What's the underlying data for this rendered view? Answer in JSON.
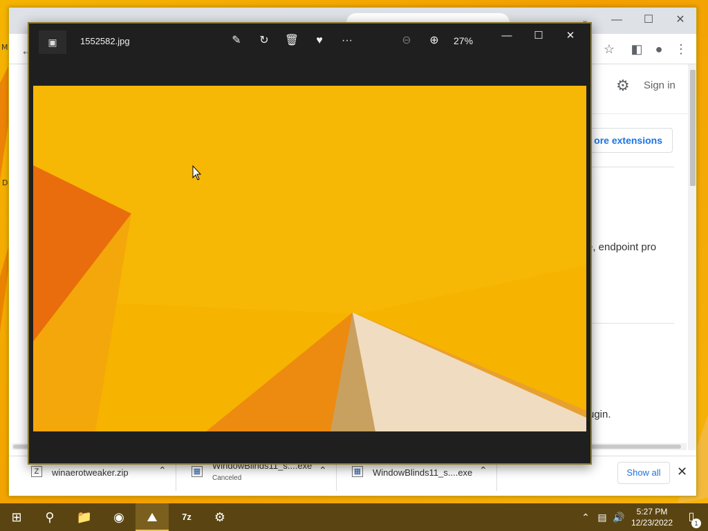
{
  "photos": {
    "filename": "1552582.jpg",
    "zoom": "27%",
    "toolbar": {
      "edit_icon": "edit-image-icon",
      "rotate_icon": "rotate-icon",
      "delete_icon": "trash-icon",
      "favorite_icon": "heart-icon",
      "more_icon": "more-icon",
      "zoom_out_icon": "zoom-out-icon",
      "zoom_in_icon": "zoom-in-icon"
    }
  },
  "browser": {
    "signin_label": "Sign in",
    "more_extensions_label": "ore extensions",
    "text_endpoint": "e, endpoint pro",
    "text_plugin": "ugin."
  },
  "downloads": {
    "items": [
      {
        "name": "winaerotweaker.zip",
        "sub": ""
      },
      {
        "name": "WindowBlinds11_s....exe",
        "sub": "Canceled"
      },
      {
        "name": "WindowBlinds11_s....exe",
        "sub": ""
      }
    ],
    "show_all_label": "Show all"
  },
  "desktop": {
    "label_m": "M",
    "label_d": "D"
  },
  "taskbar": {
    "time": "5:27 PM",
    "date": "12/23/2022",
    "notification_count": "1",
    "apps": [
      "start-icon",
      "search-icon",
      "file-explorer-icon",
      "chrome-icon",
      "photos-icon",
      "7zip-icon",
      "installer-icon"
    ]
  },
  "colors": {
    "wallpaper": "#f5b400",
    "taskbar": "#5a4512",
    "photos_chrome": "#1f1f1f",
    "link_blue": "#1a73e8"
  }
}
